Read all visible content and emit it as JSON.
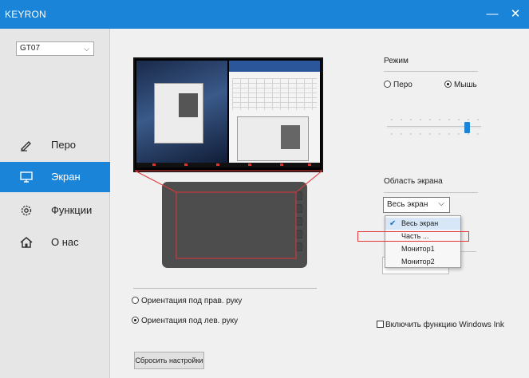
{
  "app": {
    "title": "KEYRON",
    "minimize_glyph": "—",
    "close_glyph": "✕"
  },
  "sidebar": {
    "device": {
      "value": "GT07",
      "chevron": "⌵"
    },
    "items": [
      {
        "id": "pen",
        "label": "Перо",
        "icon": "pen-icon",
        "active": false
      },
      {
        "id": "screen",
        "label": "Экран",
        "icon": "monitor-icon",
        "active": true
      },
      {
        "id": "functions",
        "label": "Функции",
        "icon": "gear-icon",
        "active": false
      },
      {
        "id": "about",
        "label": "О нас",
        "icon": "home-icon",
        "active": false
      }
    ]
  },
  "orientation": {
    "right_hand": {
      "label": "Ориентация под прав. руку",
      "selected": false
    },
    "left_hand": {
      "label": "Ориентация под лев. руку",
      "selected": true
    }
  },
  "reset_button": "Сбросить настройки",
  "mode": {
    "label": "Режим",
    "options": [
      {
        "label": "Перо",
        "selected": false
      },
      {
        "label": "Мышь",
        "selected": true
      }
    ],
    "slider_value_fraction": 0.87
  },
  "screen_area": {
    "label": "Область экрана",
    "selected": "Весь экран",
    "chevron": "⌵",
    "options": [
      {
        "label": "Весь экран",
        "checked": true
      },
      {
        "label": "Часть ...",
        "checked": false
      },
      {
        "label": "Монитор1",
        "checked": false
      },
      {
        "label": "Монитор2",
        "checked": false
      }
    ],
    "check_glyph": "✔"
  },
  "windows_ink": {
    "label": "Включить функцию Windows Ink",
    "checked": false
  },
  "colors": {
    "accent": "#1a84d8",
    "highlight_red": "#e0383a",
    "sidebar_bg": "#e6e6e6",
    "main_bg": "#f0f0f0"
  }
}
